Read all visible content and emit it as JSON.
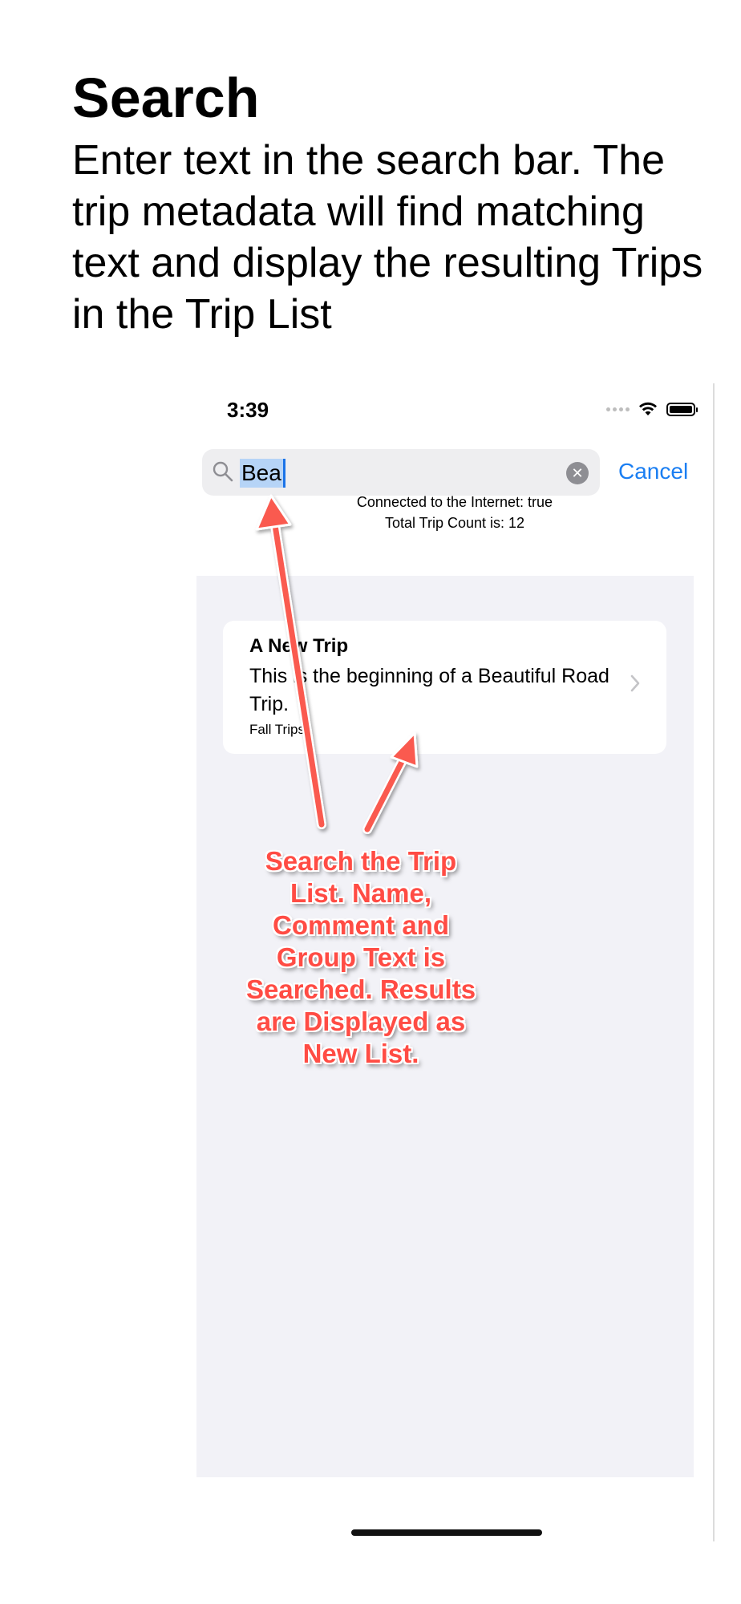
{
  "header": {
    "title": "Search",
    "description": "Enter text in the search bar. The trip metadata will find matching text and display the resulting Trips in the Trip List"
  },
  "status_bar": {
    "time": "3:39"
  },
  "search": {
    "value": "Bea",
    "cancel_label": "Cancel"
  },
  "info": {
    "connected": "Connected to the Internet: true",
    "count": "Total Trip Count is: 12"
  },
  "trips": [
    {
      "name": "A New Trip",
      "comment": "This is the beginning of a Beautiful Road Trip.",
      "group": "Fall Trips"
    }
  ],
  "annotation": {
    "text": "Search the Trip List. Name, Comment and Group Text is Searched. Results are Displayed as New List."
  },
  "colors": {
    "accent": "#1a7ef2",
    "annotation": "#ff4c44",
    "list_background": "#f2f2f7",
    "selection": "#b6d4f7"
  },
  "icons": [
    "search-icon",
    "clear-icon",
    "chevron-right-icon",
    "wifi-icon",
    "battery-icon",
    "signal-icon",
    "arrow-icon"
  ]
}
